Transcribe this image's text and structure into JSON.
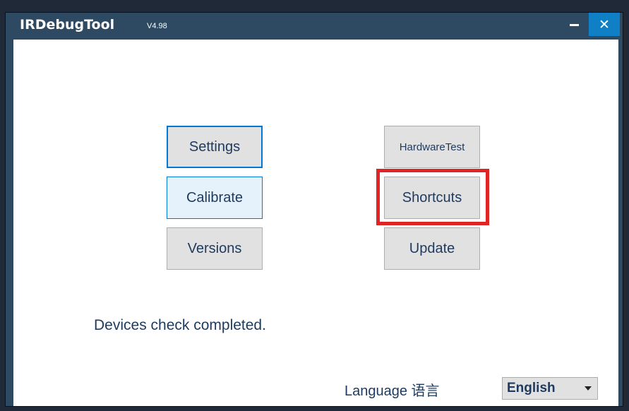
{
  "window": {
    "title": "IRDebugTool",
    "version": "V4.98",
    "minimize_icon": "minimize-icon",
    "close_icon": "close-icon",
    "close_glyph": "✕",
    "title_color": "#2e4a62",
    "close_color": "#0f7fc6"
  },
  "buttons": {
    "settings": "Settings",
    "calibrate": "Calibrate",
    "versions": "Versions",
    "hardware_test": "HardwareTest",
    "shortcuts": "Shortcuts",
    "update": "Update"
  },
  "highlight_color": "#e02424",
  "status": "Devices check completed.",
  "language": {
    "label": "Language 语言",
    "selected": "English",
    "arrow_icon": "dropdown-arrow-icon"
  }
}
